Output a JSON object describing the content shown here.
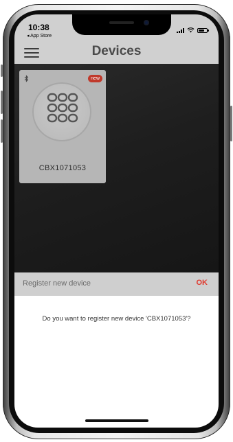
{
  "status_bar": {
    "time": "10:38",
    "back_label": "◂ App Store",
    "icons": [
      "signal-icon",
      "wifi-icon",
      "battery-icon"
    ],
    "battery_level": 0.7
  },
  "nav": {
    "menu_icon": "hamburger-menu-icon",
    "title": "Devices"
  },
  "devices": [
    {
      "name": "CBX1071053",
      "badge": "new",
      "connection_icon": "bluetooth-icon",
      "device_icon": "keypad-icon"
    }
  ],
  "dialog": {
    "title": "Register new device",
    "ok_label": "OK",
    "message": "Do you want to register new device 'CBX1071053'?"
  },
  "colors": {
    "accent": "#e03a2f",
    "badge": "#c0392b",
    "header_gray": "#d0d0d0",
    "card_gray": "#b6b6b6",
    "dim_background": "#1e1e1e"
  }
}
